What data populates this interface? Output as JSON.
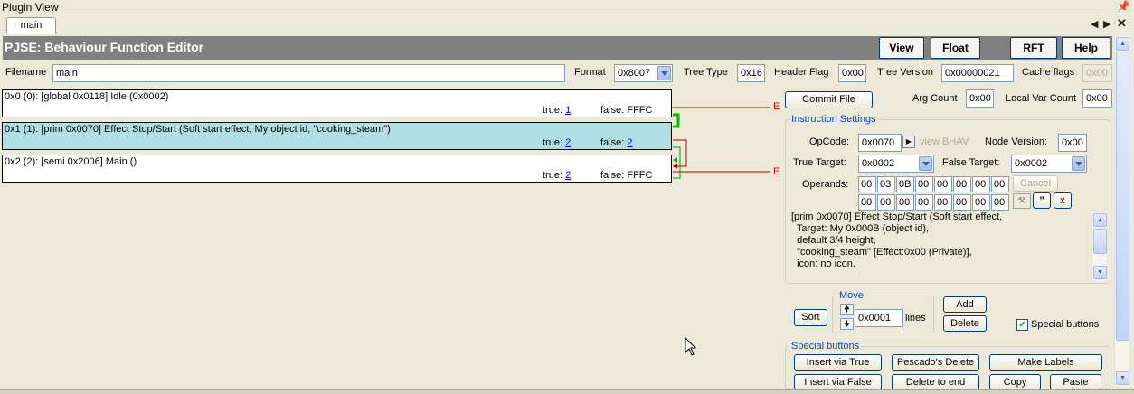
{
  "window": {
    "title": "Plugin View",
    "pin_icon": "pin-icon",
    "close_icon": "close-icon"
  },
  "tabs": [
    {
      "label": "main"
    }
  ],
  "header": {
    "title": "PJSE: Behaviour Function Editor",
    "buttons": {
      "view": "View",
      "float": "Float",
      "rft": "RFT",
      "help": "Help"
    }
  },
  "file": {
    "filename_label": "Filename",
    "filename": "main",
    "format_label": "Format",
    "format": "0x8007",
    "tree_type_label": "Tree Type",
    "tree_type": "0x16",
    "header_flag_label": "Header Flag",
    "header_flag": "0x00",
    "tree_version_label": "Tree Version",
    "tree_version": "0x00000021",
    "cache_flags_label": "Cache flags",
    "cache_flags": "0x00"
  },
  "instructions": [
    {
      "text": "0x0 (0): [global 0x0118] Idle (0x0002)",
      "true_label": "true:",
      "true_val": "1",
      "false_label": "false:",
      "false_val": "FFFC",
      "true_link": true,
      "false_link": false,
      "selected": false
    },
    {
      "text": "0x1 (1): [prim 0x0070] Effect Stop/Start (Soft start effect, My object id, \"cooking_steam\")",
      "true_label": "true:",
      "true_val": "2",
      "false_label": "false:",
      "false_val": "2",
      "true_link": true,
      "false_link": true,
      "selected": true
    },
    {
      "text": "0x2 (2): [semi 0x2006] Main ()",
      "true_label": "true:",
      "true_val": "2",
      "false_label": "false:",
      "false_val": "FFFC",
      "true_link": true,
      "false_link": false,
      "selected": false
    }
  ],
  "flow_markers": {
    "error_a": "E",
    "error_b": "E"
  },
  "commit": {
    "commit_label": "Commit File",
    "arg_count_label": "Arg Count",
    "arg_count": "0x00",
    "local_var_label": "Local Var Count",
    "local_var": "0x00"
  },
  "instruction_settings": {
    "title": "Instruction Settings",
    "opcode_label": "OpCode:",
    "opcode": "0x0070",
    "view_bhav": "view BHAV",
    "node_version_label": "Node Version:",
    "node_version": "0x00",
    "true_target_label": "True Target:",
    "true_target": "0x0002",
    "false_target_label": "False Target:",
    "false_target": "0x0002",
    "operands_label": "Operands:",
    "operands_row1": [
      "00",
      "03",
      "0B",
      "00",
      "00",
      "00",
      "00",
      "00"
    ],
    "operands_row2": [
      "00",
      "00",
      "00",
      "00",
      "00",
      "00",
      "00",
      "00"
    ],
    "cancel_label": "Cancel",
    "quote_label": "”",
    "x_label": "x",
    "description": "[prim 0x0070] Effect Stop/Start (Soft start effect,\n  Target: My 0x000B (object id),\n  default 3/4 height,\n  \"cooking_steam\" [Effect:0x00 (Private)],\n  icon: no icon,"
  },
  "move": {
    "title": "Move",
    "sort_label": "Sort",
    "lines_value": "0x0001",
    "lines_label": "lines",
    "add_label": "Add",
    "delete_label": "Delete",
    "special_checkbox_label": "Special buttons",
    "special_checked": true
  },
  "special_buttons": {
    "title": "Special buttons",
    "insert_via_true": "Insert via True",
    "pescado_delete": "Pescado's Delete",
    "make_labels": "Make Labels",
    "insert_via_false": "Insert via False",
    "delete_to_end": "Delete to end",
    "copy": "Copy",
    "paste": "Paste"
  },
  "colors": {
    "header_bg": "#808080",
    "selected_row": "#b0e0e6",
    "true_arrow": "#00a000",
    "false_arrow": "#c00000",
    "group_title": "#0046d5"
  }
}
